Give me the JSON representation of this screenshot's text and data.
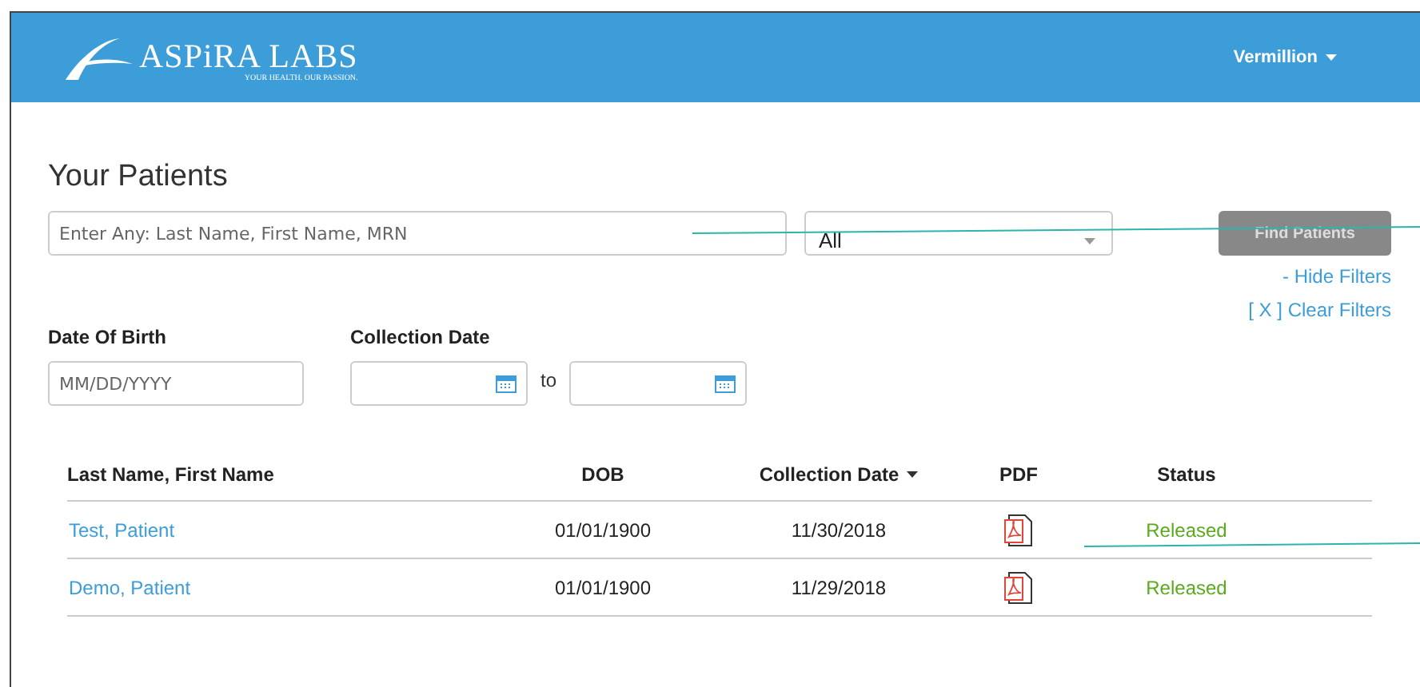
{
  "header": {
    "logo": {
      "name": "ASPiRA LABS",
      "tagline": "YOUR HEALTH. OUR PASSION."
    },
    "user_menu": "Vermillion"
  },
  "page_title": "Your Patients",
  "search": {
    "placeholder": "Enter Any: Last Name, First Name, MRN"
  },
  "filter_select": {
    "value": "All"
  },
  "find_button": {
    "label": "Find Patients",
    "disabled": true
  },
  "filter_links": [
    "- Hide Filters",
    "[ X ] Clear Filters"
  ],
  "date_of_birth": {
    "label": "Date Of Birth",
    "placeholder": "MM/DD/YYYY"
  },
  "collection_date": {
    "label": "Collection Date",
    "separator": "to"
  },
  "table": {
    "columns": [
      {
        "label": "Last Name, First Name",
        "sorted": false
      },
      {
        "label": "DOB",
        "sorted": false
      },
      {
        "label": "Collection Date",
        "sorted": true
      },
      {
        "label": "PDF",
        "sorted": false
      },
      {
        "label": "Status",
        "sorted": false
      }
    ],
    "rows": [
      {
        "name": "Test, Patient",
        "dob": "01/01/1900",
        "collection_date": "11/30/2018",
        "status": "Released"
      },
      {
        "name": "Demo, Patient",
        "dob": "01/01/1900",
        "collection_date": "11/29/2018",
        "status": "Released"
      }
    ]
  }
}
